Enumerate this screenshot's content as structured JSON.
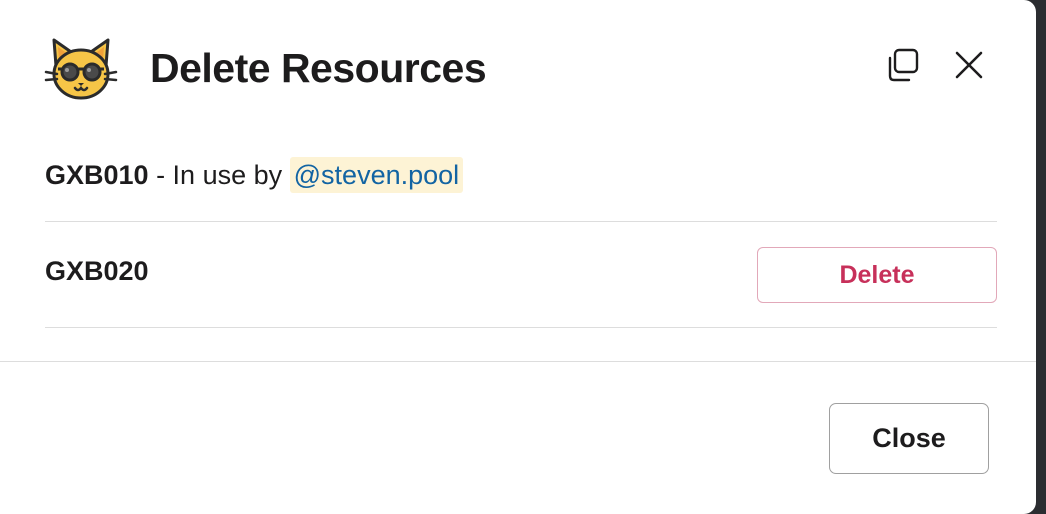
{
  "modal": {
    "title": "Delete Resources",
    "app_icon": "cat-sunglasses-icon",
    "header_icons": [
      "copy-icon",
      "close-icon"
    ]
  },
  "resources": [
    {
      "id": "GXB010",
      "status_prefix": " - In use by ",
      "mention": "@steven.pool"
    },
    {
      "id": "GXB020",
      "action_label": "Delete"
    }
  ],
  "footer": {
    "close_label": "Close"
  },
  "colors": {
    "delete_text": "#c7305a",
    "delete_border": "#e2a8b9",
    "mention_bg": "#fdf3d5",
    "mention_text": "#1264a3",
    "divider": "#dddddd"
  }
}
